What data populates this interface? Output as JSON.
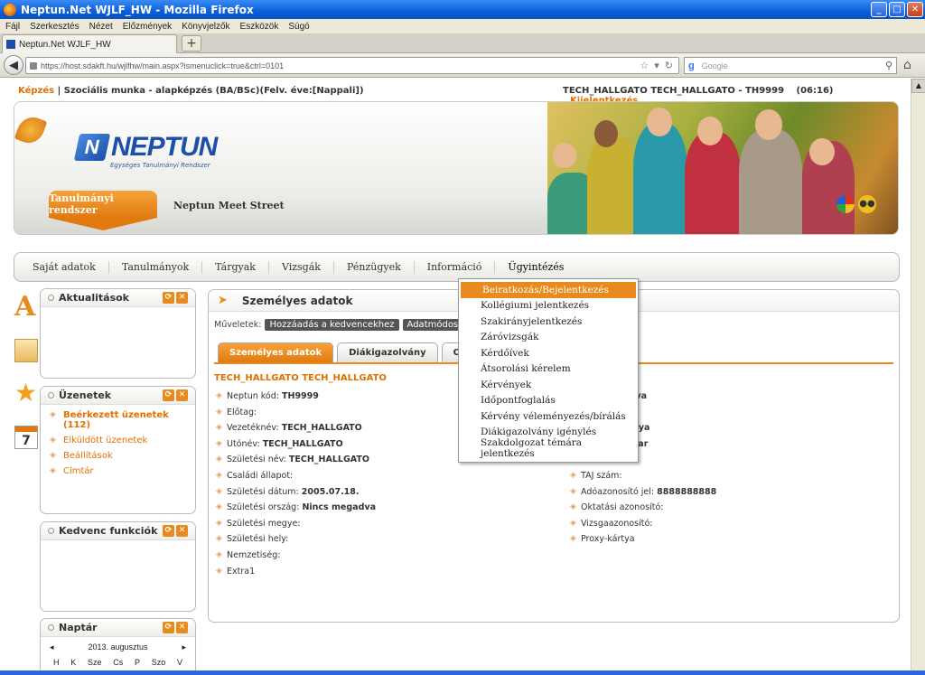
{
  "window": {
    "title": "Neptun.Net WJLF_HW - Mozilla Firefox"
  },
  "menubar": [
    "Fájl",
    "Szerkesztés",
    "Nézet",
    "Előzmények",
    "Könyvjelzők",
    "Eszközök",
    "Súgó"
  ],
  "tab": {
    "label": "Neptun.Net WJLF_HW",
    "new_tab": "+"
  },
  "address": {
    "url": "https://host.sdakft.hu/wjlfhw/main.aspx?ismenuclick=true&ctrl=0101",
    "search_placeholder": "Google"
  },
  "topinfo": {
    "training": "Képzés",
    "separator": "|",
    "program": "Szociális munka - alapképzés (BA/BSc)(Felv. éve:[Nappali])",
    "user": "TECH_HALLGATO TECH_HALLGATO - TH9999",
    "time": "(06:16)",
    "logout": "Kijelentkezés"
  },
  "banner": {
    "logo_letter": "N",
    "logo_text": "NEPTUN",
    "logo_sub": "Egységes Tanulmányi Rendszer",
    "system_button": "Tanulmányi rendszer",
    "meet_street": "Neptun Meet Street"
  },
  "mainmenu": [
    "Saját adatok",
    "Tanulmányok",
    "Tárgyak",
    "Vizsgák",
    "Pénzügyek",
    "Információ",
    "Ügyintézés"
  ],
  "dropdown": [
    "Beiratkozás/Bejelentkezés",
    "Kollégiumi jelentkezés",
    "Szakirányjelentkezés",
    "Záróvizsgák",
    "Kérdőívek",
    "Átsorolási kérelem",
    "Kérvények",
    "Időpontfoglalás",
    "Kérvény véleményezés/bírálás",
    "Diákigazolvány igénylés",
    "Szakdolgozat témára jelentkezés"
  ],
  "boxes": {
    "news": {
      "title": "Aktualitások"
    },
    "messages": {
      "title": "Üzenetek",
      "links": [
        "Beérkezett üzenetek (112)",
        "Elküldött üzenetek",
        "Beállítások",
        "Címtár"
      ]
    },
    "favorites": {
      "title": "Kedvenc funkciók"
    },
    "calendar": {
      "title": "Naptár",
      "month": "2013. augusztus",
      "prev": "◂",
      "next": "▸",
      "days": [
        "H",
        "K",
        "Sze",
        "Cs",
        "P",
        "Szo",
        "V"
      ]
    }
  },
  "panel": {
    "title": "Személyes adatok",
    "ops_label": "Műveletek:",
    "ops": [
      "Hozzáadás a kedvencekhez",
      "Adatmódos"
    ],
    "tabs": [
      "Személyes adatok",
      "Diákigazolvány",
      "Okmá"
    ],
    "name": "TECH_HALLGATO TECH_HALLGATO",
    "left_fields": [
      {
        "label": "Neptun kód:",
        "value": "TH9999"
      },
      {
        "label": "Előtag:",
        "value": ""
      },
      {
        "label": "Vezetéknév:",
        "value": "TECH_HALLGATO"
      },
      {
        "label": "Utónév:",
        "value": "TECH_HALLGATO"
      },
      {
        "label": "Születési név:",
        "value": "TECH_HALLGATO"
      },
      {
        "label": "Családi állapot:",
        "value": ""
      },
      {
        "label": "Születési dátum:",
        "value": "2005.07.18."
      },
      {
        "label": "Születési ország:",
        "value": "Nincs megadva"
      },
      {
        "label": "Születési megye:",
        "value": ""
      },
      {
        "label": "Születési hely:",
        "value": ""
      },
      {
        "label": "Nemzetiség:",
        "value": ""
      },
      {
        "label": "Extra1",
        "value": ""
      }
    ],
    "right_partial": [
      "egadva",
      "",
      "ch Anya",
      "magyar",
      "n: 0"
    ],
    "right_fields": [
      {
        "label": "TAJ szám:",
        "value": ""
      },
      {
        "label": "Adóazonosító jel:",
        "value": "8888888888"
      },
      {
        "label": "Oktatási azonosító:",
        "value": ""
      },
      {
        "label": "Vizsgaazonosító:",
        "value": ""
      },
      {
        "label": "Proxy-kártya",
        "value": ""
      }
    ]
  }
}
